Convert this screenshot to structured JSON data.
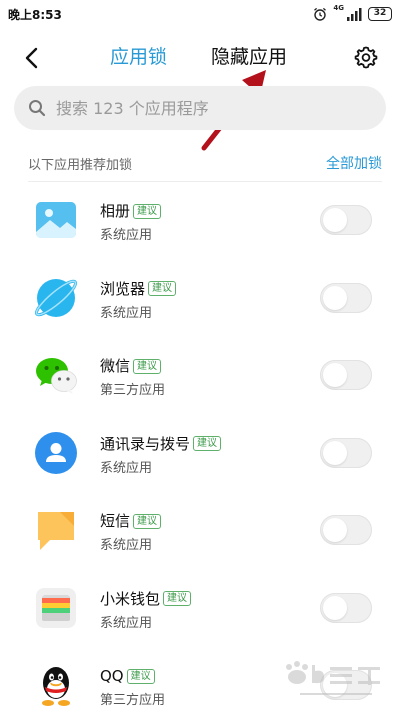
{
  "status_bar": {
    "time": "晚上8:53",
    "network": "4G",
    "battery": "32"
  },
  "header": {
    "tabs": [
      {
        "label": "应用锁",
        "active": true
      },
      {
        "label": "隐藏应用",
        "active": false
      }
    ]
  },
  "search": {
    "placeholder": "搜索 123 个应用程序"
  },
  "section": {
    "title": "以下应用推荐加锁",
    "action": "全部加锁"
  },
  "apps": [
    {
      "name": "相册",
      "badge": "建议",
      "type": "系统应用",
      "icon": "gallery-icon",
      "locked": false
    },
    {
      "name": "浏览器",
      "badge": "建议",
      "type": "系统应用",
      "icon": "browser-icon",
      "locked": false
    },
    {
      "name": "微信",
      "badge": "建议",
      "type": "第三方应用",
      "icon": "wechat-icon",
      "locked": false
    },
    {
      "name": "通讯录与拨号",
      "badge": "建议",
      "type": "系统应用",
      "icon": "contacts-icon",
      "locked": false
    },
    {
      "name": "短信",
      "badge": "建议",
      "type": "系统应用",
      "icon": "messages-icon",
      "locked": false
    },
    {
      "name": "小米钱包",
      "badge": "建议",
      "type": "系统应用",
      "icon": "wallet-icon",
      "locked": false
    },
    {
      "name": "QQ",
      "badge": "建议",
      "type": "第三方应用",
      "icon": "qq-icon",
      "locked": false
    }
  ],
  "colors": {
    "accent": "#2a9ad6",
    "badge_green": "#3c9a4a",
    "annotation_arrow": "#b3121c"
  },
  "watermark": {
    "logo": "Baidu 经验",
    "url": "jingyan.baidu.com"
  }
}
